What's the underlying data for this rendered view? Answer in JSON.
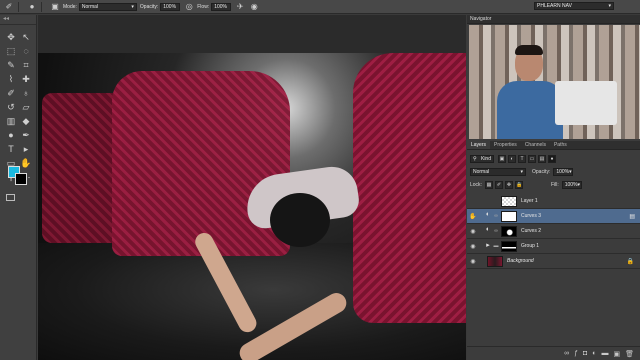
{
  "options_bar": {
    "mode_label": "Mode:",
    "mode_value": "Normal",
    "opacity_label": "Opacity:",
    "opacity_value": "100%",
    "flow_label": "Flow:",
    "flow_value": "100%",
    "workspace_value": "PHLEARN NAV"
  },
  "tools": {
    "grip": "◂◂",
    "items": [
      {
        "name": "move-tool-icon",
        "glyph": "✥"
      },
      {
        "name": "artboard-tool-icon",
        "glyph": "↖"
      },
      {
        "name": "marquee-tool-icon",
        "glyph": "⬚"
      },
      {
        "name": "lasso-tool-icon",
        "glyph": "◌"
      },
      {
        "name": "quick-select-tool-icon",
        "glyph": "✎"
      },
      {
        "name": "crop-tool-icon",
        "glyph": "⌗"
      },
      {
        "name": "eyedropper-tool-icon",
        "glyph": "⌇"
      },
      {
        "name": "spot-healing-tool-icon",
        "glyph": "✚"
      },
      {
        "name": "brush-tool-icon",
        "glyph": "✐"
      },
      {
        "name": "clone-stamp-tool-icon",
        "glyph": "♁"
      },
      {
        "name": "history-brush-tool-icon",
        "glyph": "↺"
      },
      {
        "name": "eraser-tool-icon",
        "glyph": "▱"
      },
      {
        "name": "gradient-tool-icon",
        "glyph": "▥"
      },
      {
        "name": "blur-tool-icon",
        "glyph": "◆"
      },
      {
        "name": "dodge-tool-icon",
        "glyph": "●"
      },
      {
        "name": "pen-tool-icon",
        "glyph": "✒"
      },
      {
        "name": "type-tool-icon",
        "glyph": "T"
      },
      {
        "name": "path-select-tool-icon",
        "glyph": "▸"
      },
      {
        "name": "shape-tool-icon",
        "glyph": "▭"
      },
      {
        "name": "hand-tool-icon",
        "glyph": "✋"
      },
      {
        "name": "zoom-tool-icon",
        "glyph": "⚲"
      },
      {
        "name": "extra-tool-icon",
        "glyph": "⋯"
      }
    ],
    "foreground_color": "#1ab9e0",
    "background_color": "#000000"
  },
  "navigator": {
    "title": "Navigator"
  },
  "layers_panel": {
    "tabs": [
      "Layers",
      "Properties",
      "Channels",
      "Paths"
    ],
    "active_tab": "Layers",
    "filter_label": "Kind",
    "blend_mode": "Normal",
    "opacity_label": "Opacity:",
    "opacity_value": "100%",
    "lock_label": "Lock:",
    "fill_label": "Fill:",
    "fill_value": "100%",
    "layers": [
      {
        "name": "Layer 1",
        "visible": false,
        "type": "pixel",
        "selected": false,
        "italic": false
      },
      {
        "name": "Curves 3",
        "visible": true,
        "type": "adjustment",
        "selected": true,
        "italic": false
      },
      {
        "name": "Curves 2",
        "visible": true,
        "type": "adjustment",
        "selected": false,
        "italic": false
      },
      {
        "name": "Group 1",
        "visible": true,
        "type": "group",
        "selected": false,
        "italic": false
      },
      {
        "name": "Background",
        "visible": true,
        "type": "background",
        "selected": false,
        "italic": true
      }
    ]
  }
}
